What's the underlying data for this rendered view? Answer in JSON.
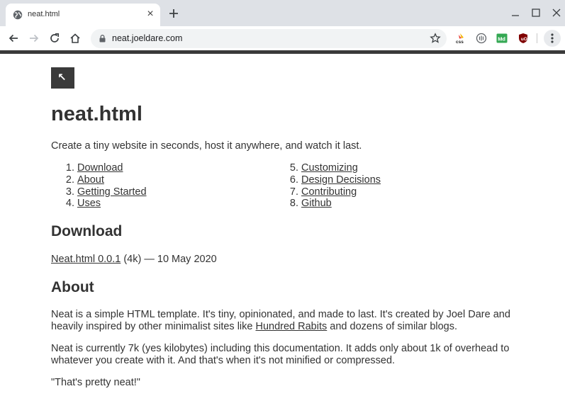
{
  "browser": {
    "tab_title": "neat.html",
    "url": "neat.joeldare.com"
  },
  "page": {
    "up_glyph": "↖",
    "title": "neat.html",
    "tagline": "Create a tiny website in seconds, host it anywhere, and watch it last.",
    "toc_left": [
      {
        "num": "1.",
        "label": "Download"
      },
      {
        "num": "2.",
        "label": "About"
      },
      {
        "num": "3.",
        "label": "Getting Started"
      },
      {
        "num": "4.",
        "label": "Uses"
      }
    ],
    "toc_right": [
      {
        "num": "5.",
        "label": "Customizing"
      },
      {
        "num": "6.",
        "label": "Design Decisions"
      },
      {
        "num": "7.",
        "label": "Contributing"
      },
      {
        "num": "8.",
        "label": "Github"
      }
    ],
    "download": {
      "heading": "Download",
      "link": "Neat.html 0.0.1",
      "meta": " (4k) — 10 May 2020"
    },
    "about": {
      "heading": "About",
      "p1_before": "Neat is a simple HTML template. It's tiny, opinionated, and made to last. It's created by Joel Dare and heavily inspired by other minimalist sites like ",
      "p1_link": "Hundred Rabits",
      "p1_after": " and dozens of similar blogs.",
      "p2": "Neat is currently 7k (yes kilobytes) including this documentation. It adds only about 1k of overhead to whatever you create with it. And that's when it's not minified or compressed.",
      "p3": "\"That's pretty neat!\""
    }
  }
}
